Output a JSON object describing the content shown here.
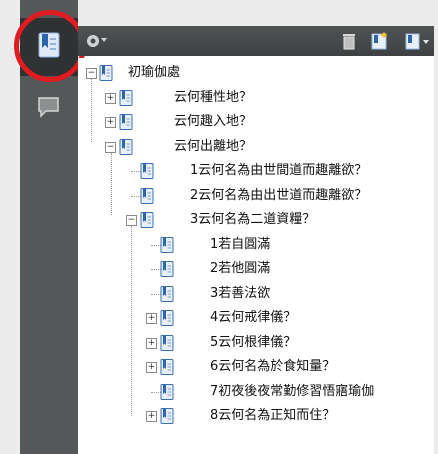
{
  "sidebar": {
    "tabs": [
      {
        "name": "bookmarks-tab",
        "icon": "bookmark-panel-icon",
        "active": true
      },
      {
        "name": "comments-tab",
        "icon": "comment-icon",
        "active": false
      }
    ],
    "highlight_color": "#e11b22"
  },
  "toolbar": {
    "icons": [
      "options-gear-icon",
      "delete-bookmark-icon",
      "new-bookmark-icon",
      "bookmark-dropdown-icon"
    ]
  },
  "tree": {
    "root": {
      "label": "初瑜伽處",
      "expanded": true
    },
    "items": [
      {
        "label": "云何種性地？",
        "level": 1,
        "expander": "+"
      },
      {
        "label": "云何趣入地？",
        "level": 1,
        "expander": "+"
      },
      {
        "label": "云何出離地？",
        "level": 1,
        "expander": "-"
      },
      {
        "label": "1云何名為由世間道而趣離欲？",
        "level": 2,
        "expander": ""
      },
      {
        "label": "2云何名為由出世道而趣離欲？",
        "level": 2,
        "expander": ""
      },
      {
        "label": "3云何名為二道資糧？",
        "level": 2,
        "expander": "-"
      },
      {
        "label": "1若自圓滿",
        "level": 3,
        "expander": ""
      },
      {
        "label": "2若他圓滿",
        "level": 3,
        "expander": ""
      },
      {
        "label": "3若善法欲",
        "level": 3,
        "expander": ""
      },
      {
        "label": "4云何戒律儀？",
        "level": 3,
        "expander": "+"
      },
      {
        "label": "5云何根律儀？",
        "level": 3,
        "expander": "+"
      },
      {
        "label": "6云何名為於食知量？",
        "level": 3,
        "expander": "+"
      },
      {
        "label": "7初夜後夜常勤修習悟寤瑜伽",
        "level": 3,
        "expander": ""
      },
      {
        "label": "8云何名為正知而住？",
        "level": 3,
        "expander": "+"
      }
    ]
  }
}
